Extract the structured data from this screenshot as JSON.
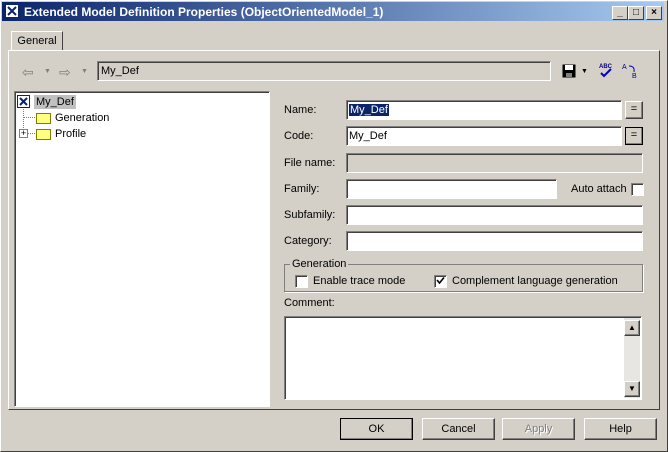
{
  "window": {
    "title": "Extended Model Definition Properties (ObjectOrientedModel_1)",
    "controls": [
      "_",
      "□",
      "×"
    ]
  },
  "tabs": [
    "General"
  ],
  "toolbar": {
    "back": "⇦",
    "forward": "⇨",
    "path": "My_Def"
  },
  "tree": {
    "root": "My_Def",
    "children": [
      "Generation",
      "Profile"
    ]
  },
  "form": {
    "name_label": "Name:",
    "name_value": "My_Def",
    "code_label": "Code:",
    "code_value": "My_Def",
    "filename_label": "File name:",
    "filename_value": "",
    "family_label": "Family:",
    "family_value": "",
    "auto_attach_label": "Auto attach",
    "subfamily_label": "Subfamily:",
    "subfamily_value": "",
    "category_label": "Category:",
    "category_value": "",
    "generation_group": "Generation",
    "enable_trace_label": "Enable trace mode",
    "enable_trace_checked": false,
    "complement_label": "Complement language generation",
    "complement_checked": true,
    "comment_label": "Comment:",
    "comment_value": "",
    "eq": "="
  },
  "buttons": {
    "ok": "OK",
    "cancel": "Cancel",
    "apply": "Apply",
    "help": "Help"
  }
}
